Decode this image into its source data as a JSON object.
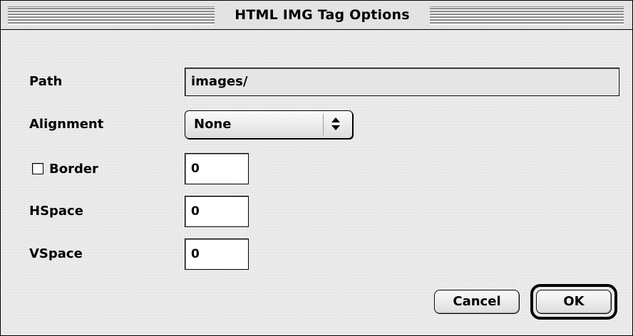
{
  "window": {
    "title": "HTML IMG Tag Options"
  },
  "fields": {
    "path": {
      "label": "Path",
      "value": "images/"
    },
    "alignment": {
      "label": "Alignment",
      "selected": "None"
    },
    "border": {
      "label": "Border",
      "checked": false,
      "value": "0"
    },
    "hspace": {
      "label": "HSpace",
      "value": "0"
    },
    "vspace": {
      "label": "VSpace",
      "value": "0"
    }
  },
  "buttons": {
    "cancel_label": "Cancel",
    "ok_label": "OK",
    "default": "OK"
  },
  "colors": {
    "window_background": "#ebebeb",
    "text": "#000000",
    "field_background": "#ffffff"
  },
  "icons": {
    "popup_arrows": "up-down-arrows-icon"
  }
}
